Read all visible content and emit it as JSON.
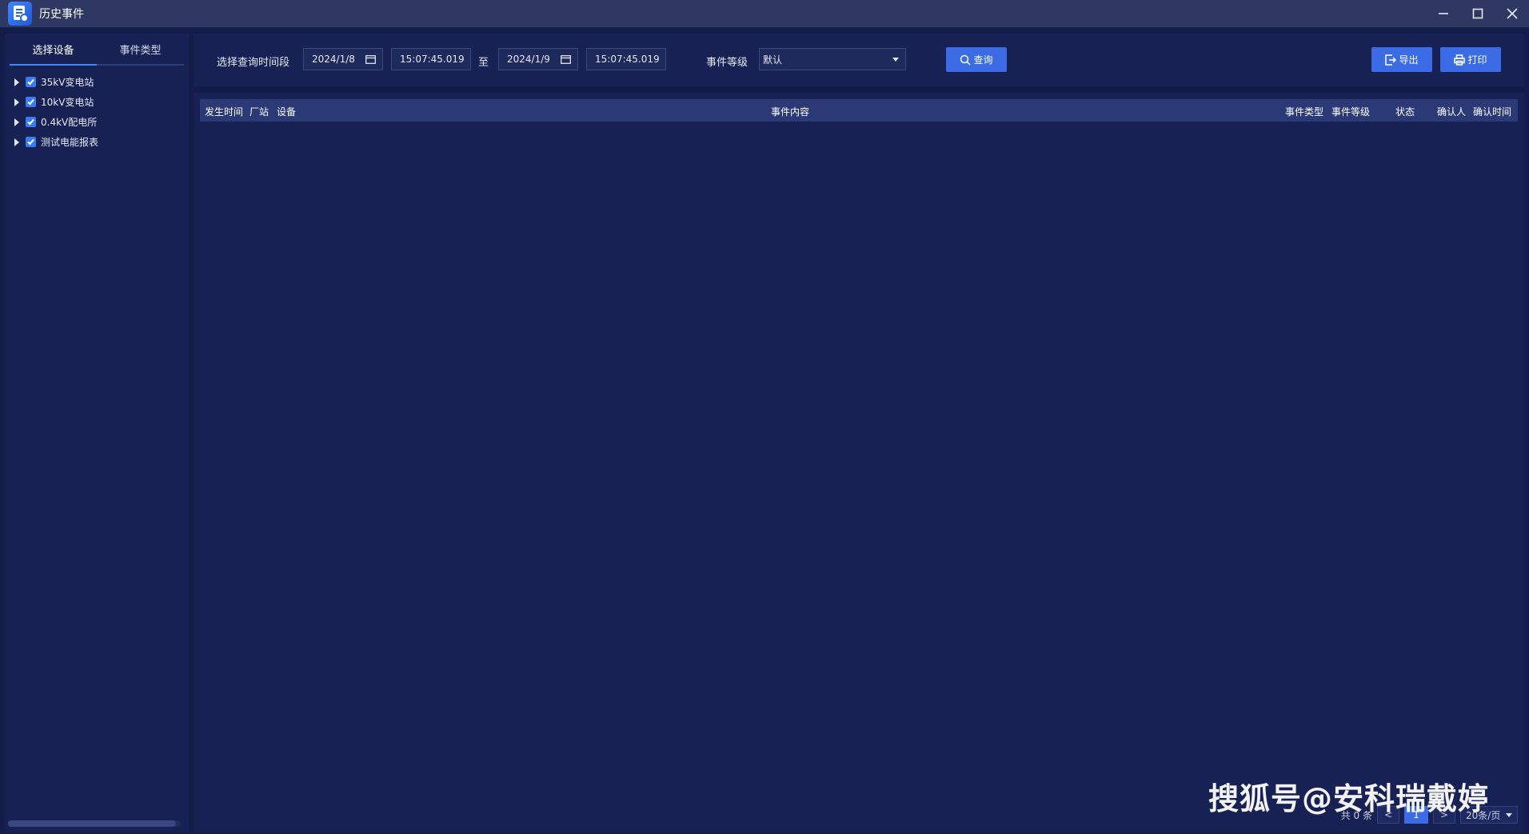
{
  "window": {
    "title": "历史事件"
  },
  "sidebar": {
    "tabs": [
      {
        "label": "选择设备",
        "active": true
      },
      {
        "label": "事件类型",
        "active": false
      }
    ],
    "tree": [
      {
        "label": "35kV变电站",
        "checked": true
      },
      {
        "label": "10kV变电站",
        "checked": true
      },
      {
        "label": "0.4kV配电所",
        "checked": true
      },
      {
        "label": "测试电能报表",
        "checked": true
      }
    ]
  },
  "toolbar": {
    "period_label": "选择查询时间段",
    "start_date": "2024/1/8",
    "start_time": "15:07:45.019",
    "to_label": "至",
    "end_date": "2024/1/9",
    "end_time": "15:07:45.019",
    "level_label": "事件等级",
    "level_value": "默认",
    "query_label": "查询",
    "export_label": "导出",
    "print_label": "打印"
  },
  "table": {
    "columns": [
      "发生时间",
      "厂站",
      "设备",
      "事件内容",
      "事件类型",
      "事件等级",
      "状态",
      "确认人",
      "确认时间"
    ],
    "rows": []
  },
  "pagination": {
    "total_text": "共 0 条",
    "current_page": "1",
    "page_size": "20条/页"
  },
  "watermark": "搜狐号@安科瑞戴婷",
  "colors": {
    "background": "#141d4a",
    "panel": "#172153",
    "accent": "#3b6ce6",
    "table_header": "#2b3a76"
  }
}
